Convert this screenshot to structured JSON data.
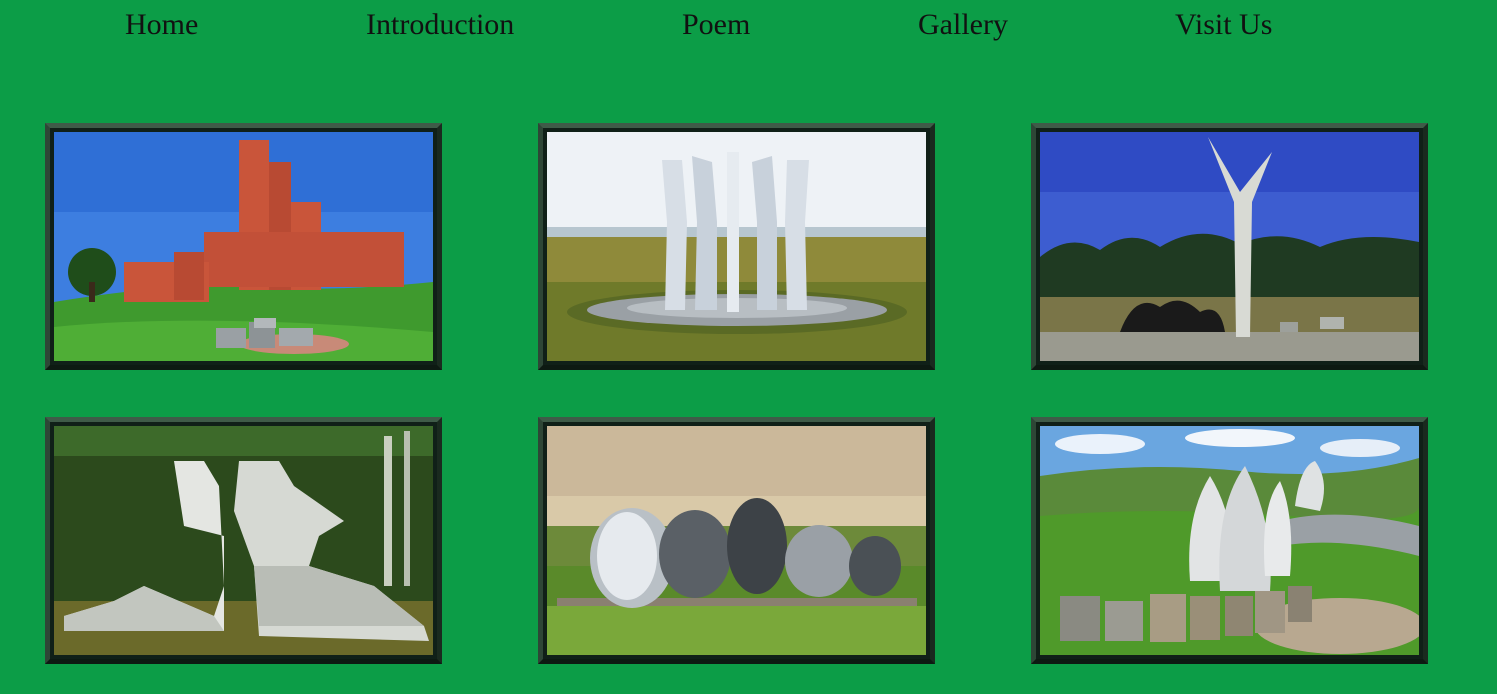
{
  "nav": {
    "items": [
      {
        "label": "Home"
      },
      {
        "label": "Introduction"
      },
      {
        "label": "Poem"
      },
      {
        "label": "Gallery"
      },
      {
        "label": "Visit Us"
      }
    ]
  },
  "colors": {
    "background": "#0c9d47",
    "frame_border": "#1a2a1f",
    "nav_text": "#111111"
  },
  "gallery": {
    "images": [
      {
        "depicts": "red brick tiered monument on grassy hill"
      },
      {
        "depicts": "white concrete sculpture on circular stone base in field"
      },
      {
        "depicts": "tall white Y-shaped spomenik with dark sculpture at base"
      },
      {
        "depicts": "white fractured concrete sculpture before forest"
      },
      {
        "depicts": "polished metal disc sculptures in meadow at sunset"
      },
      {
        "depicts": "white petal-shaped stone sculptures with stone path"
      }
    ]
  }
}
